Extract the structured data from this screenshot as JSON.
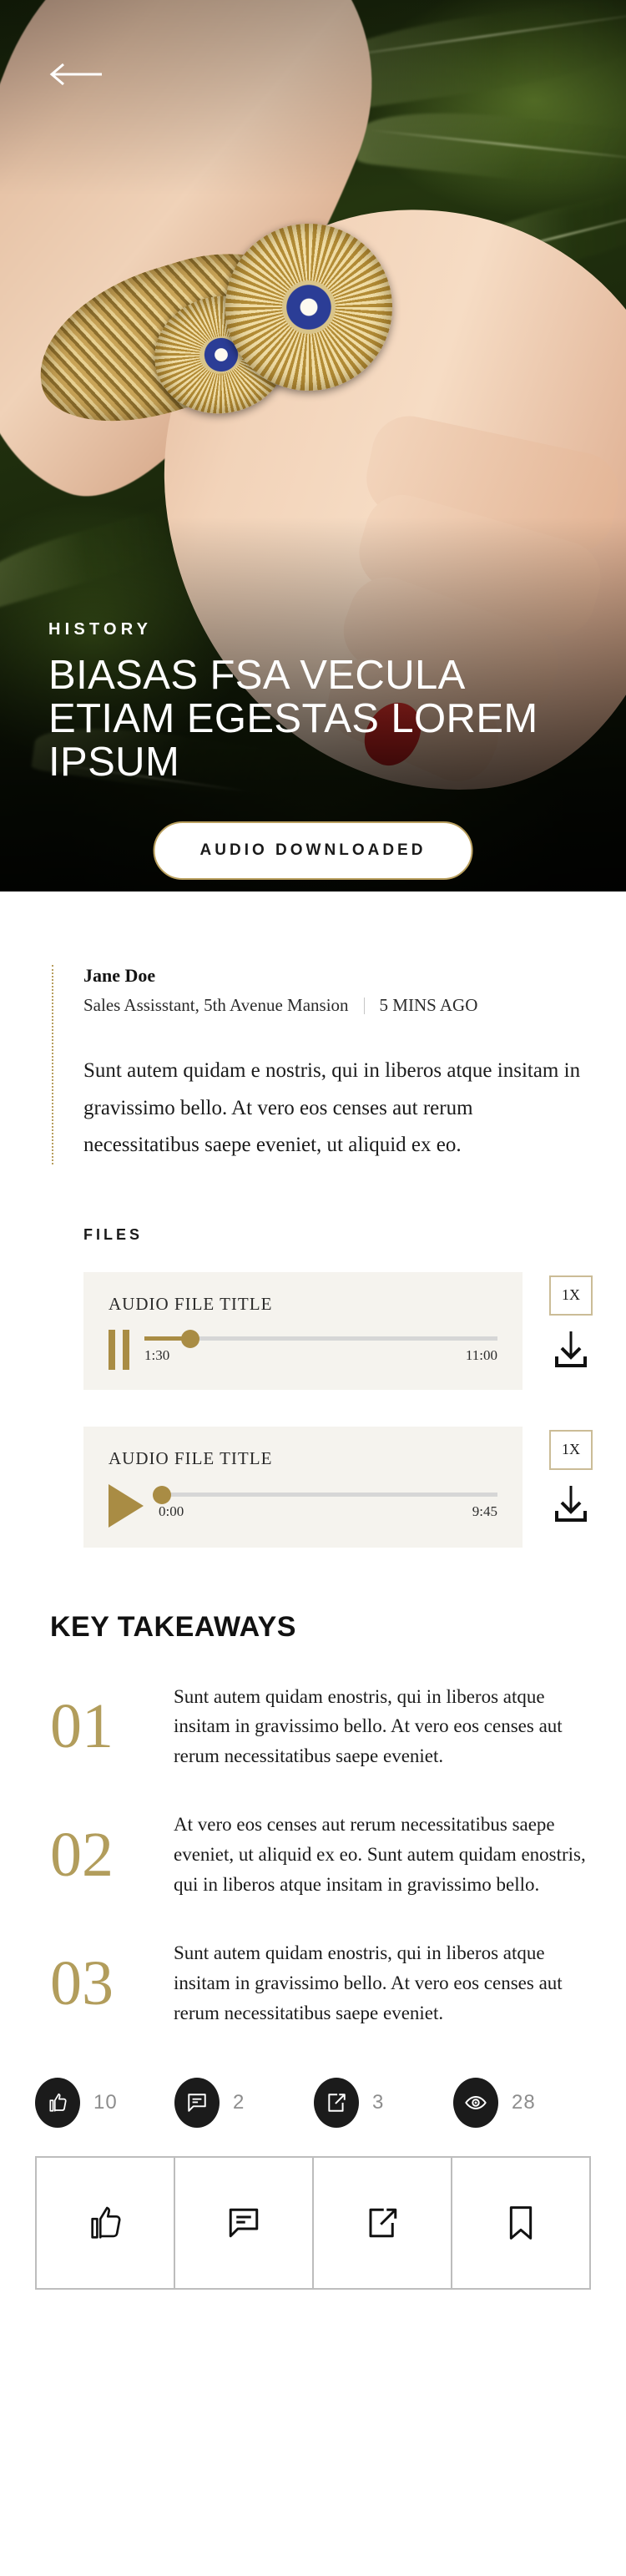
{
  "hero": {
    "back_icon": "arrow-left-icon",
    "kicker": "HISTORY",
    "headline": "BIASAS FSA VECULA ETIAM EGESTAS LOREM IPSUM",
    "audio_pill_label": "AUDIO DOWNLOADED",
    "accent_gold": "#b99f5e"
  },
  "article": {
    "author": "Jane Doe",
    "role": "Sales Assisstant, 5th Avenue Mansion",
    "timestamp": "5 MINS AGO",
    "lede": "Sunt autem quidam e nostris, qui in liberos atque insitam in gravissimo bello. At vero eos censes aut rerum necessitatibus saepe eveniet, ut aliquid ex eo."
  },
  "files": {
    "section_label": "FILES",
    "download_icon": "download-icon",
    "players": [
      {
        "title": "AUDIO FILE TITLE",
        "state": "playing",
        "transport_icon": "pause-icon",
        "current_time": "1:30",
        "total_time": "11:00",
        "progress_percent": 13,
        "speed_label": "1X"
      },
      {
        "title": "AUDIO FILE TITLE",
        "state": "paused",
        "transport_icon": "play-icon",
        "current_time": "0:00",
        "total_time": "9:45",
        "progress_percent": 1,
        "speed_label": "1X"
      }
    ]
  },
  "takeaways": {
    "heading": "KEY TAKEAWAYS",
    "items": [
      {
        "number": "01",
        "text": "Sunt autem quidam enostris, qui in liberos atque insitam in gravissimo bello. At vero eos censes aut rerum necessitatibus saepe eveniet."
      },
      {
        "number": "02",
        "text": "At vero eos censes aut rerum necessitatibus saepe eveniet, ut aliquid ex eo. Sunt autem quidam enostris, qui in liberos atque insitam in gravissimo bello."
      },
      {
        "number": "03",
        "text": "Sunt autem quidam enostris, qui in liberos atque insitam in gravissimo bello. At vero eos censes aut rerum necessitatibus saepe eveniet."
      }
    ],
    "number_color": "#b29d5c"
  },
  "stats": [
    {
      "icon": "thumbs-up-icon",
      "value": "10"
    },
    {
      "icon": "comment-icon",
      "value": "2"
    },
    {
      "icon": "share-icon",
      "value": "3"
    },
    {
      "icon": "eye-icon",
      "value": "28"
    }
  ],
  "actions": [
    {
      "icon": "thumbs-up-icon"
    },
    {
      "icon": "comment-icon"
    },
    {
      "icon": "share-icon"
    },
    {
      "icon": "bookmark-icon"
    }
  ]
}
